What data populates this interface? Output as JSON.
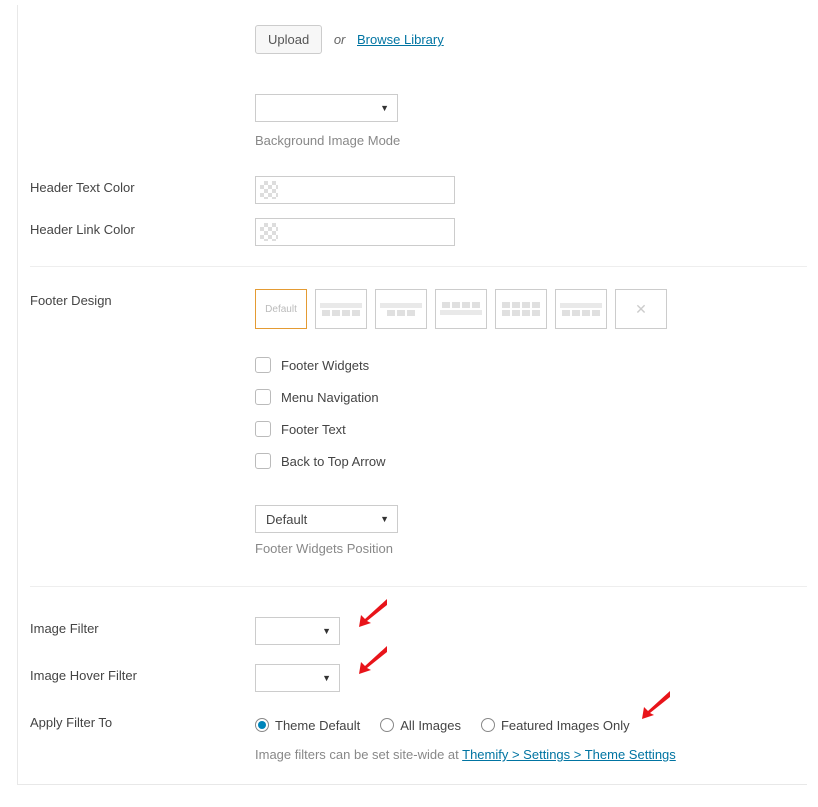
{
  "upload": {
    "button": "Upload",
    "or": "or",
    "link": "Browse Library"
  },
  "bgmode": {
    "hint": "Background Image Mode"
  },
  "labels": {
    "header_text_color": "Header Text Color",
    "header_link_color": "Header Link Color",
    "footer_design": "Footer Design",
    "image_filter": "Image Filter",
    "image_hover_filter": "Image Hover Filter",
    "apply_filter_to": "Apply Filter To"
  },
  "footer": {
    "default_label": "Default",
    "checks": {
      "widgets": "Footer Widgets",
      "menu": "Menu Navigation",
      "text": "Footer Text",
      "back": "Back to Top Arrow"
    },
    "position_value": "Default",
    "position_hint": "Footer Widgets Position"
  },
  "filter": {
    "radios": {
      "theme_default": "Theme Default",
      "all_images": "All Images",
      "featured": "Featured Images Only"
    },
    "helper_prefix": "Image filters can be set site-wide at ",
    "helper_link": "Themify > Settings > Theme Settings"
  }
}
